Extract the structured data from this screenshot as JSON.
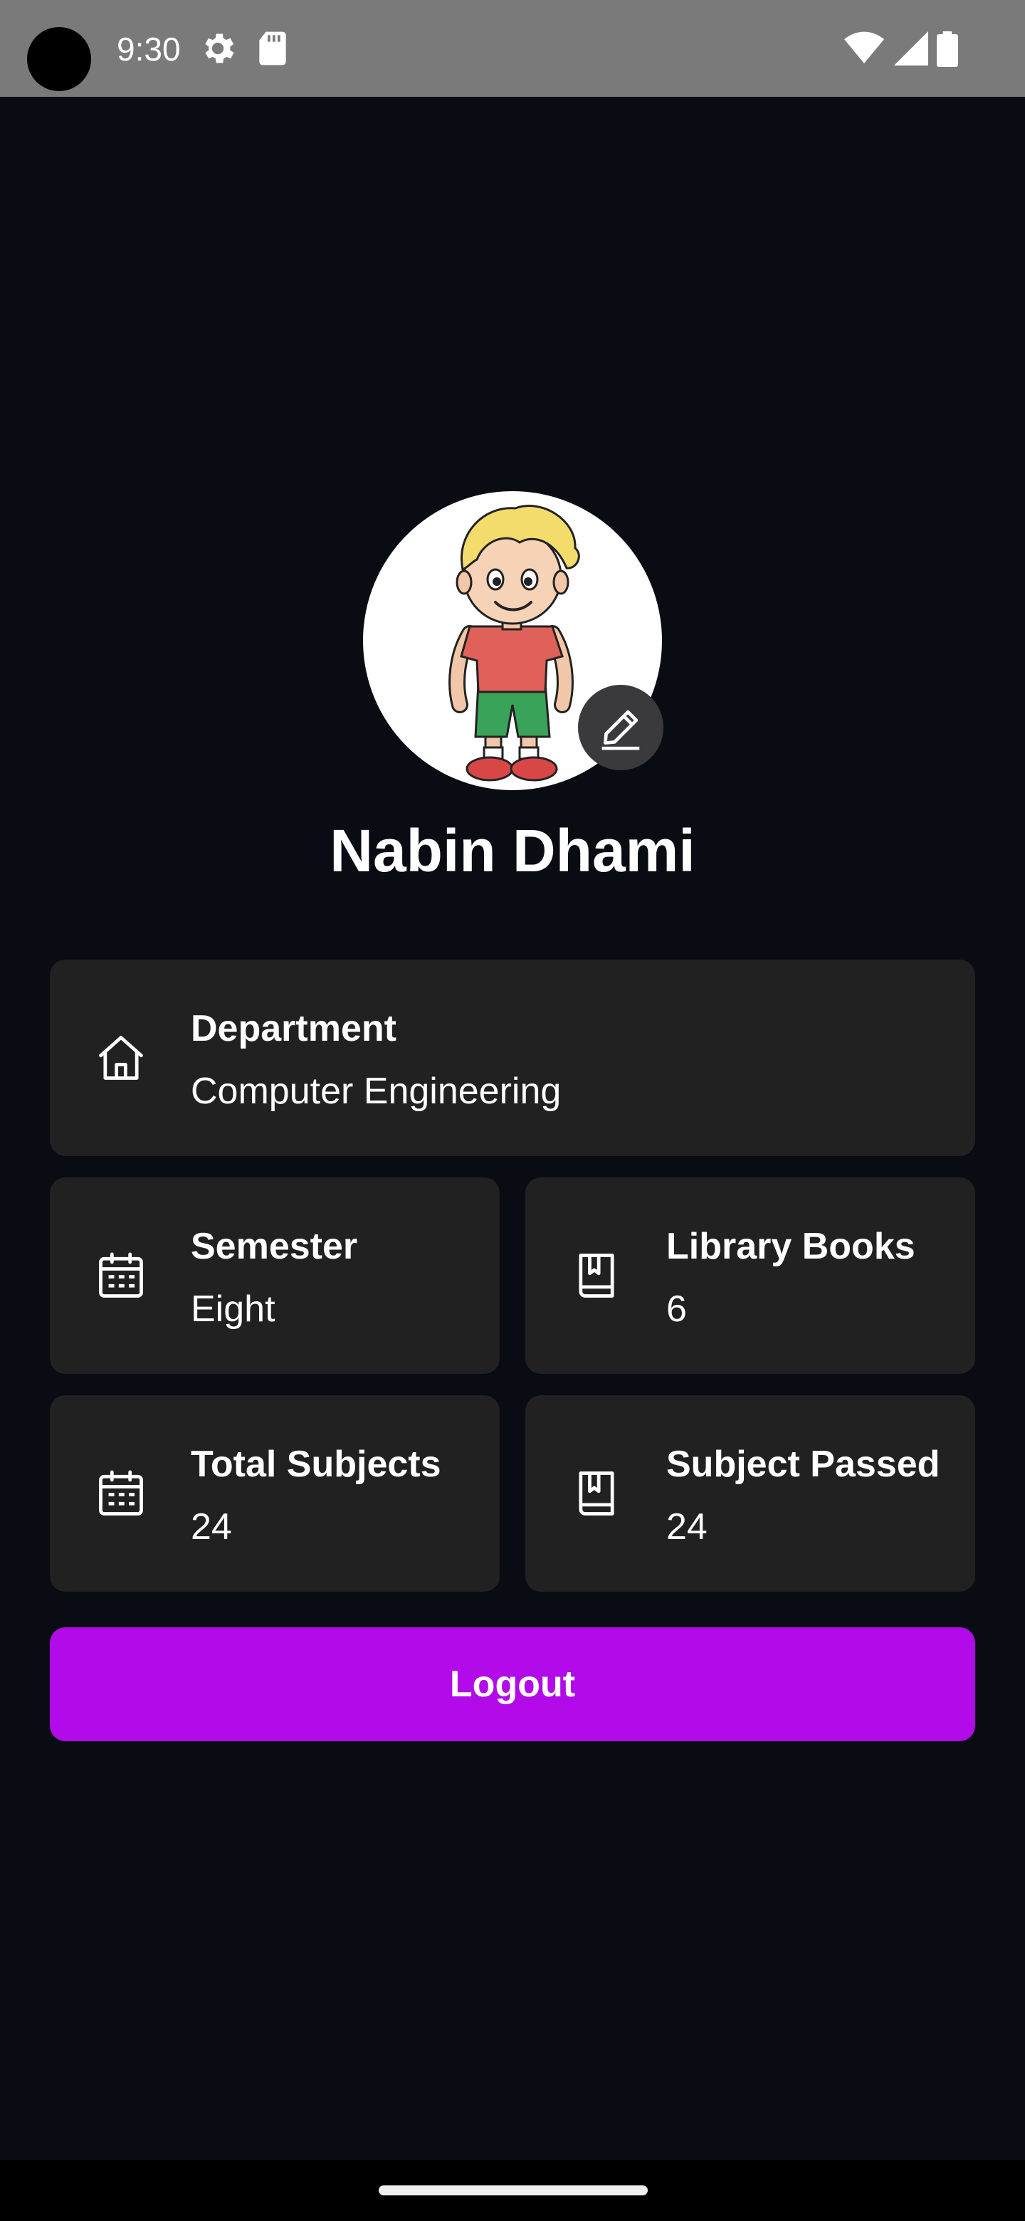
{
  "status_bar": {
    "time": "9:30",
    "icons": [
      "settings-gear-icon",
      "sd-card-icon",
      "wifi-icon",
      "cell-signal-icon",
      "battery-icon"
    ]
  },
  "profile": {
    "name": "Nabin Dhami",
    "avatar": "cartoon-boy-avatar",
    "edit_icon": "pencil-edit-icon"
  },
  "cards": {
    "department": {
      "title": "Department",
      "value": "Computer Engineering",
      "icon": "home-icon"
    },
    "semester": {
      "title": "Semester",
      "value": "Eight",
      "icon": "calendar-icon"
    },
    "library_books": {
      "title": "Library Books",
      "value": "6",
      "icon": "book-icon"
    },
    "total_subjects": {
      "title": "Total Subjects",
      "value": "24",
      "icon": "calendar-icon"
    },
    "subject_passed": {
      "title": "Subject Passed",
      "value": "24",
      "icon": "book-icon"
    }
  },
  "logout": {
    "label": "Logout"
  },
  "colors": {
    "background": "#0a0c14",
    "card": "#212121",
    "accent": "#b20ae8",
    "status_bar": "#7a7a7a"
  }
}
